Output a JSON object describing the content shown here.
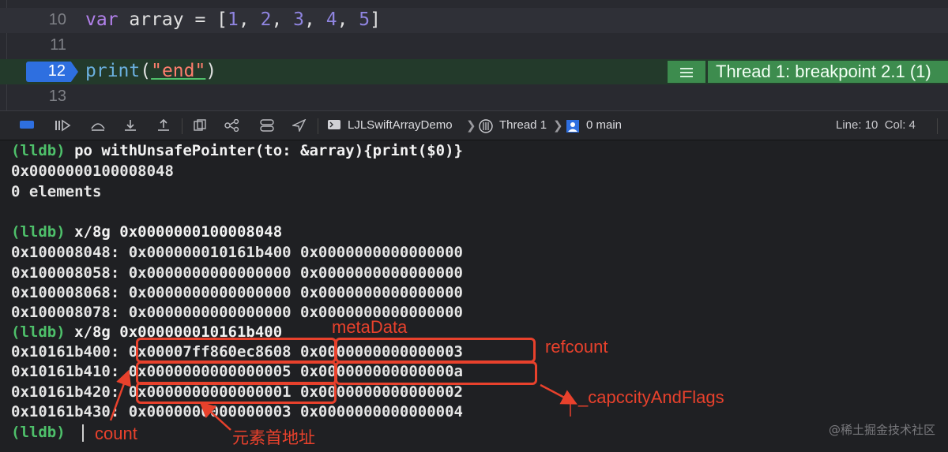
{
  "editor": {
    "lines": [
      {
        "num": "10",
        "kw": "var",
        "rest": " array = [",
        "nums": [
          "1",
          "2",
          "3",
          "4",
          "5"
        ],
        "close": "]"
      },
      {
        "num": "11"
      },
      {
        "num": "12",
        "fn": "print",
        "open": "(",
        "str": "\"end\"",
        "close": ")"
      },
      {
        "num": "13"
      }
    ],
    "thread_label": "Thread 1: breakpoint 2.1 (1)"
  },
  "toolbar": {
    "scheme": "LJLSwiftArrayDemo",
    "thread": "Thread 1",
    "frame": "0 main",
    "line_col": "Line: 10  Col: 4"
  },
  "console": {
    "lines": [
      {
        "prompt": "(lldb)",
        "cmd": " po withUnsafePointer(to: &array){print($0)}"
      },
      {
        "text": "0x0000000100008048"
      },
      {
        "text": "0 elements"
      },
      {
        "text": ""
      },
      {
        "prompt": "(lldb)",
        "cmd": " x/8g 0x0000000100008048"
      },
      {
        "text": "0x100008048: 0x000000010161b400 0x0000000000000000"
      },
      {
        "text": "0x100008058: 0x0000000000000000 0x0000000000000000"
      },
      {
        "text": "0x100008068: 0x0000000000000000 0x0000000000000000"
      },
      {
        "text": "0x100008078: 0x0000000000000000 0x0000000000000000"
      },
      {
        "prompt": "(lldb)",
        "cmd": " x/8g 0x000000010161b400"
      },
      {
        "text": "0x10161b400: 0x00007ff860ec8608 0x0000000000000003"
      },
      {
        "text": "0x10161b410: 0x0000000000000005 0x000000000000000a"
      },
      {
        "text": "0x10161b420: 0x0000000000000001 0x0000000000000002"
      },
      {
        "text": "0x10161b430: 0x0000000000000003 0x0000000000000004"
      },
      {
        "prompt": "(lldb)",
        "cmd": ""
      }
    ]
  },
  "annotations": {
    "metadata": "metaData",
    "refcount": "refcount",
    "capacity": "_capccityAndFlags",
    "count": "count",
    "first_element": "元素首地址"
  },
  "watermark": "@稀土掘金技术社区"
}
